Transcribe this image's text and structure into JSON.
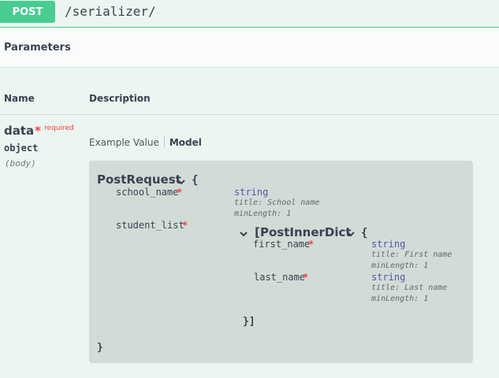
{
  "endpoint": {
    "method": "POST",
    "path": "/serializer/"
  },
  "section": {
    "title": "Parameters"
  },
  "table": {
    "col_name": "Name",
    "col_description": "Description"
  },
  "param": {
    "name": "data",
    "required_star": "*",
    "required_label": "required",
    "type": "object",
    "location": "(body)"
  },
  "tabs": {
    "example_value": "Example Value",
    "model": "Model",
    "active": "Model"
  },
  "model": {
    "title": "PostRequest",
    "open_brace": "{",
    "close_brace": "}",
    "properties": [
      {
        "name": "school_name",
        "required": "*",
        "type": "string",
        "title": "title: School name",
        "min_length": "minLength: 1"
      },
      {
        "name": "student_list",
        "required": "*",
        "inner": {
          "open_bracket": "[",
          "title": "PostInnerDict",
          "open_brace": "{",
          "close": "}]",
          "properties": [
            {
              "name": "first_name",
              "required": "*",
              "type": "string",
              "title": "title: First name",
              "min_length": "minLength: 1"
            },
            {
              "name": "last_name",
              "required": "*",
              "type": "string",
              "title": "title: Last name",
              "min_length": "minLength: 1"
            }
          ]
        }
      }
    ]
  },
  "icons": {
    "collapse": "chevron-down-icon"
  },
  "colors": {
    "post_green": "#49cc90",
    "required_red": "#f93e3e",
    "background": "#ebf6f0",
    "model_box": "#d1dcd7"
  }
}
